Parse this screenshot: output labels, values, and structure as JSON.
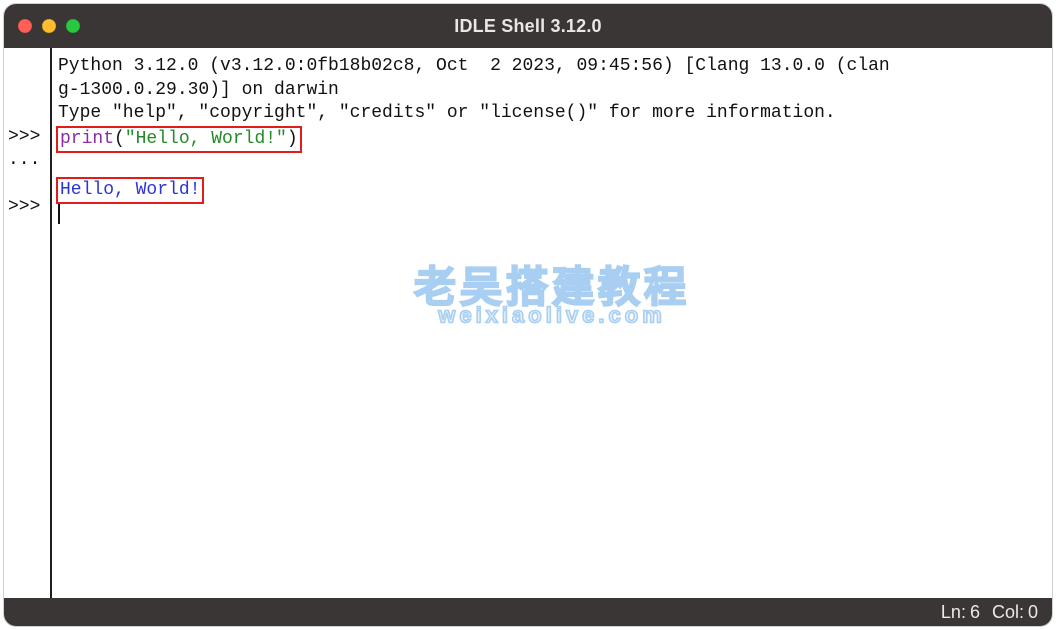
{
  "window": {
    "title": "IDLE Shell 3.12.0"
  },
  "gutter_lines": [
    "",
    "",
    "",
    ">>>",
    "...",
    "",
    ">>>"
  ],
  "banner": {
    "line1": "Python 3.12.0 (v3.12.0:0fb18b02c8, Oct  2 2023, 09:45:56) [Clang 13.0.0 (clan",
    "line2": "g-1300.0.29.30)] on darwin",
    "line3": "Type \"help\", \"copyright\", \"credits\" or \"license()\" for more information."
  },
  "input": {
    "fn": "print",
    "open": "(",
    "string": "\"Hello, World!\"",
    "close": ")"
  },
  "output": "Hello, World!",
  "status": {
    "ln_label": "Ln:",
    "ln": "6",
    "col_label": "Col:",
    "col": "0"
  },
  "watermark": {
    "cn": "老吴搭建教程",
    "en": "weixiaolive.com"
  }
}
